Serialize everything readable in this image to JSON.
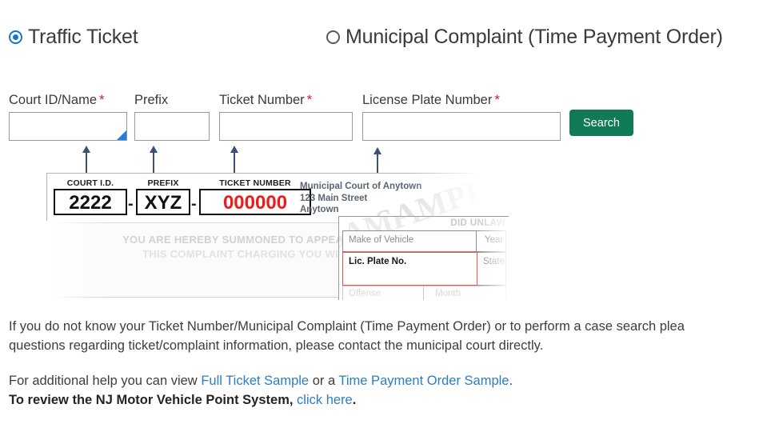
{
  "radios": {
    "options": [
      {
        "label": "Traffic Ticket",
        "checked": true
      },
      {
        "label": "Municipal Complaint (Time Payment Order)",
        "checked": false
      }
    ]
  },
  "form": {
    "fields": [
      {
        "label": "Court ID/Name",
        "required_mark": "*",
        "value": "",
        "placeholder": ""
      },
      {
        "label": "Prefix",
        "required_mark": "",
        "value": "",
        "placeholder": ""
      },
      {
        "label": "Ticket Number",
        "required_mark": "*",
        "value": "",
        "placeholder": ""
      },
      {
        "label": "License Plate Number",
        "required_mark": "*",
        "value": "",
        "placeholder": ""
      }
    ],
    "search_label": "Search",
    "search_color": "#0f7a55",
    "required_color": "#c32040"
  },
  "ticket_sample": {
    "court_id_caption": "COURT I.D.",
    "court_id_value": "2222",
    "prefix_caption": "PREFIX",
    "prefix_value": "XYZ",
    "ticket_caption": "TICKET NUMBER",
    "ticket_value": "000000",
    "dash1": "-",
    "dash2": "-",
    "ticket_value_color": "#ef1b1b",
    "address_line1": "Municipal Court of Anytown",
    "address_line2": "123 Main Street",
    "address_line3": "Anytown",
    "watermark": "SAMPLE",
    "summons_line1": "YOU ARE HEREBY SUMMONED TO APPEAR BEFORE T",
    "summons_line2": "THIS COMPLAINT CHARGING YOU WITH THE O"
  },
  "overlay": {
    "header": "DID UNLAW",
    "watermark": "SAMPLE",
    "make_label": "Make of Vehicle",
    "year_label": "Year",
    "plate_label": "Lic. Plate No.",
    "state_label": "State",
    "offense_label": "Offense",
    "month_label": "Month",
    "highlight_color": "#e8534a"
  },
  "body": {
    "main_line1": "If you do not know your Ticket Number/Municipal Complaint (Time Payment Order) or to perform a case search plea",
    "main_line2": "questions regarding ticket/complaint information, please contact the municipal court directly.",
    "help_prefix": "For additional help you can view ",
    "help_link1": "Full Ticket Sample",
    "help_middle": " or a ",
    "help_link2": "Time Payment Order Sample",
    "help_suffix": ".",
    "points_prefix": "To review the NJ Motor Vehicle Point System, ",
    "points_link": "click here",
    "points_suffix": ".",
    "link_color": "#2e7ebf"
  }
}
